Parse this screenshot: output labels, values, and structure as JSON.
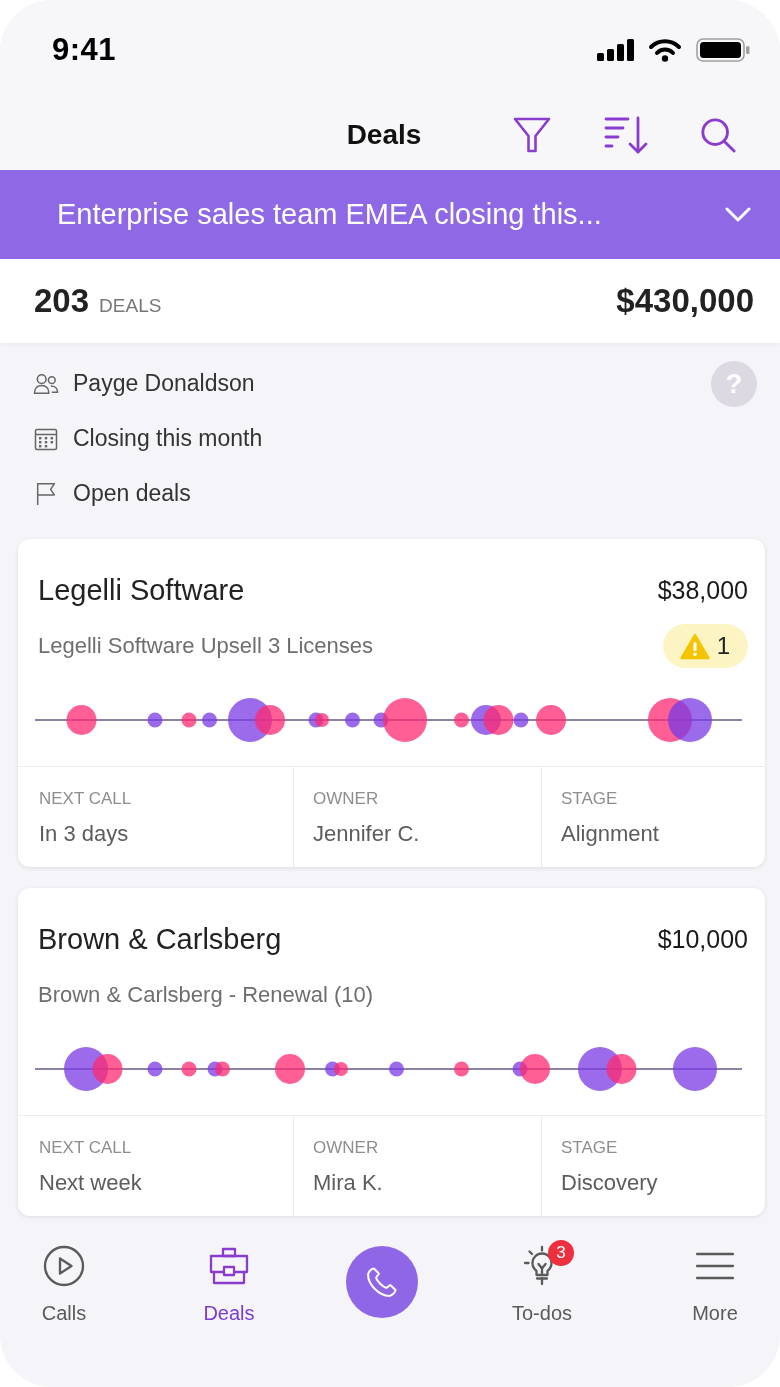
{
  "status_bar": {
    "time": "9:41"
  },
  "header": {
    "title": "Deals"
  },
  "view_selector": {
    "label": "Enterprise sales team EMEA closing this..."
  },
  "summary": {
    "count": "203",
    "count_label": "DEALS",
    "total": "$430,000"
  },
  "filters": {
    "items": [
      {
        "label": "Payge Donaldson"
      },
      {
        "label": "Closing this month"
      },
      {
        "label": "Open deals"
      }
    ],
    "help_label": "?"
  },
  "deals": [
    {
      "company": "Legelli Software",
      "amount": "$38,000",
      "deal_name": "Legelli Software Upsell 3 Licenses",
      "warning_count": "1",
      "fields": [
        {
          "label": "NEXT CALL",
          "value": "In 3 days"
        },
        {
          "label": "OWNER",
          "value": "Jennifer C."
        },
        {
          "label": "STAGE",
          "value": "Alignment"
        }
      ]
    },
    {
      "company": "Brown & Carlsberg",
      "amount": "$10,000",
      "deal_name": "Brown & Carlsberg - Renewal (10)",
      "fields": [
        {
          "label": "NEXT CALL",
          "value": "Next week"
        },
        {
          "label": "OWNER",
          "value": "Mira K."
        },
        {
          "label": "STAGE",
          "value": "Discovery"
        }
      ]
    }
  ],
  "nav": {
    "items": [
      {
        "kind": "tab",
        "label": "Calls",
        "selected": false
      },
      {
        "kind": "tab",
        "label": "Deals",
        "selected": true
      },
      {
        "kind": "action"
      },
      {
        "kind": "tab",
        "label": "To-dos",
        "selected": false,
        "badge": "3"
      },
      {
        "kind": "tab",
        "label": "More",
        "selected": false
      }
    ]
  }
}
